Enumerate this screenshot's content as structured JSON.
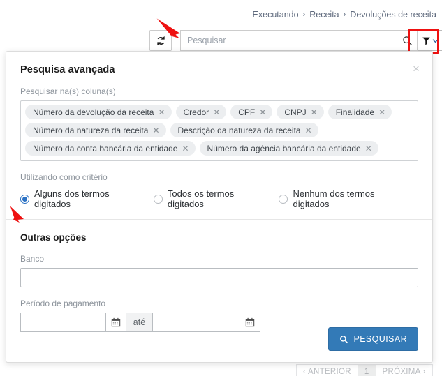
{
  "breadcrumb": {
    "items": [
      "Executando",
      "Receita",
      "Devoluções de receita"
    ],
    "separator": "›"
  },
  "toolbar": {
    "refresh_icon": "refresh-icon",
    "search_placeholder": "Pesquisar",
    "search_value": "",
    "search_icon": "search-icon",
    "filter_icon": "filter-icon",
    "filter_caret_icon": "chevron-down-icon",
    "highlight_color": "#ee1111"
  },
  "modal": {
    "title": "Pesquisa avançada",
    "close_label": "×",
    "columns_label": "Pesquisar na(s) coluna(s)",
    "chips": [
      "Número da devolução da receita",
      "Credor",
      "CPF",
      "CNPJ",
      "Finalidade",
      "Número da natureza da receita",
      "Descrição da natureza da receita",
      "Número da conta bancária da entidade",
      "Número da agência bancária da entidade"
    ],
    "chip_remove_label": "✕",
    "criteria_label": "Utilizando como critério",
    "criteria_options": [
      {
        "label": "Alguns dos termos digitados",
        "checked": true
      },
      {
        "label": "Todos os termos digitados",
        "checked": false
      },
      {
        "label": "Nenhum dos termos digitados",
        "checked": false
      }
    ],
    "other_options_title": "Outras opções",
    "bank_label": "Banco",
    "bank_value": "",
    "period_label": "Período de pagamento",
    "period_start_value": "",
    "period_end_value": "",
    "period_separator": "até",
    "calendar_icon": "calendar-icon",
    "submit_label": "PESQUISAR",
    "submit_icon": "search-icon",
    "submit_color": "#337ab7"
  },
  "pagination": {
    "previous_label": "‹ ANTERIOR",
    "current_page": "1",
    "next_label": "PRÓXIMA ›"
  },
  "annotations": {
    "arrow_color": "#ee1111",
    "arrow_search_field": "arrow-pointing-to-search-field",
    "arrow_other_options": "arrow-pointing-to-other-options"
  }
}
